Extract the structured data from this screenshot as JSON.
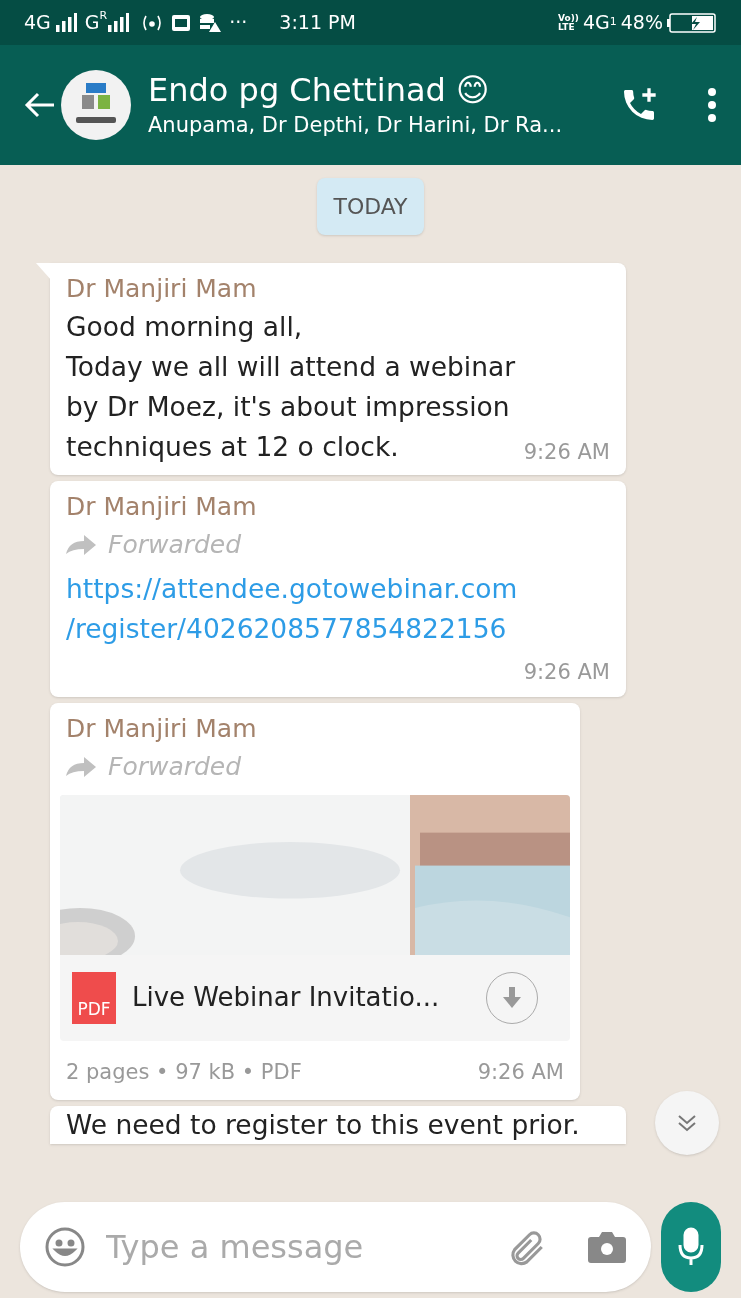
{
  "status_bar": {
    "network_1": "4G",
    "network_2": "G",
    "roaming": "R",
    "more": "···",
    "time": "3:11 PM",
    "volte": "Vo))",
    "lte": "LTE",
    "network_3": "4G",
    "sim": "1",
    "battery": "48%"
  },
  "header": {
    "title": "Endo pg Chettinad 😊",
    "subtitle": "Anupama, Dr Depthi, Dr Harini, Dr Ra..."
  },
  "date_chip": "TODAY",
  "messages": [
    {
      "kind": "text",
      "sender": "Dr Manjiri Mam",
      "forwarded": false,
      "text": "Good morning all,\nToday we all will attend a webinar by Dr Moez, it's about impression techniques at 12 o clock.",
      "time": "9:26 AM",
      "tail": true
    },
    {
      "kind": "link",
      "sender": "Dr Manjiri Mam",
      "forwarded": true,
      "forwarded_label": "Forwarded",
      "text": "https://attendee.gotowebinar.com\n/register/4026208577854822156",
      "time": "9:26 AM",
      "tail": false
    },
    {
      "kind": "document",
      "sender": "Dr Manjiri Mam",
      "forwarded": true,
      "forwarded_label": "Forwarded",
      "file_type": "PDF",
      "file_name": "Live Webinar Invitatio...",
      "meta": "2 pages • 97 kB • PDF",
      "time": "9:26 AM",
      "tail": false
    },
    {
      "kind": "partial",
      "text": "We need to register to this event prior.",
      "tail": false
    }
  ],
  "composer": {
    "placeholder": "Type a message"
  }
}
